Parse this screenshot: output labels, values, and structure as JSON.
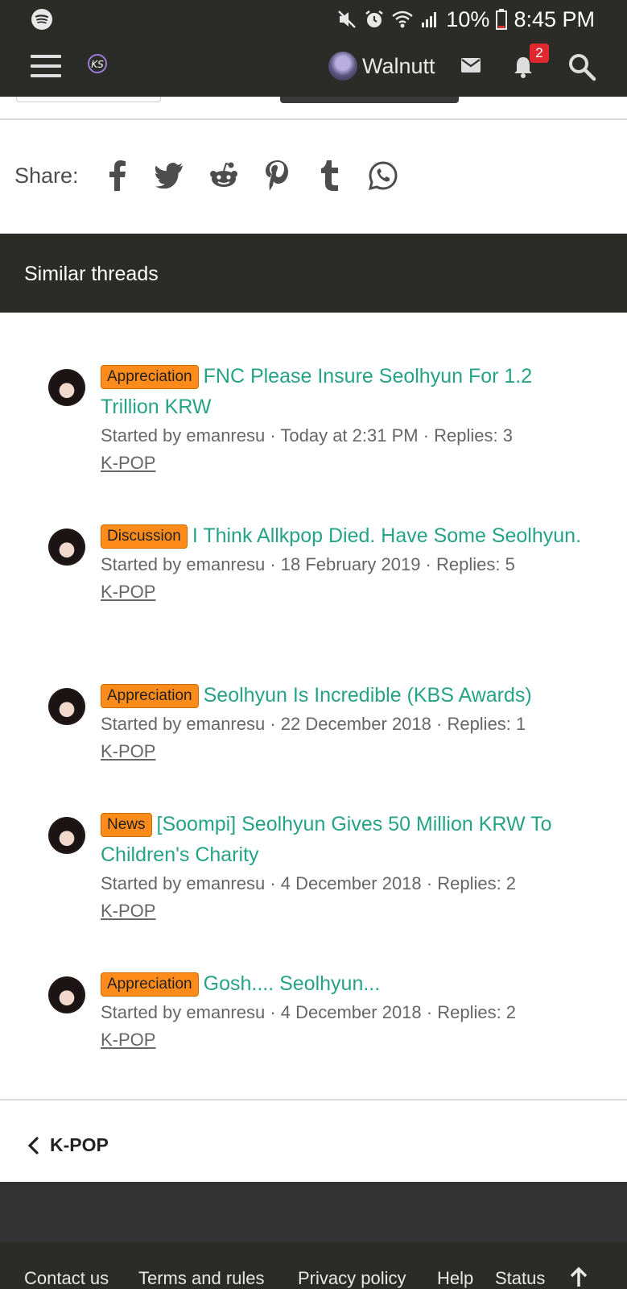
{
  "status_bar": {
    "battery": "10%",
    "time": "8:45 PM"
  },
  "nav": {
    "username": "Walnutt",
    "notification_count": "2"
  },
  "share": {
    "label": "Share:",
    "icons": [
      "facebook-icon",
      "twitter-icon",
      "reddit-icon",
      "pinterest-icon",
      "tumblr-icon",
      "whatsapp-icon"
    ]
  },
  "similar": {
    "title": "Similar threads",
    "threads": [
      {
        "prefix": "Appreciation",
        "title": "FNC Please Insure Seolhyun For 1.2 Trillion KRW",
        "meta": "Started by emanresu · Today at 2:31 PM · Replies: 3",
        "forum": "K-POP"
      },
      {
        "prefix": "Discussion",
        "title": "I Think Allkpop Died. Have Some Seolhyun.",
        "meta": "Started by emanresu · 18 February 2019 · Replies: 5",
        "forum": "K-POP"
      },
      {
        "prefix": "Appreciation",
        "title": "Seolhyun Is Incredible (KBS Awards)",
        "meta": "Started by emanresu · 22 December 2018 · Replies: 1",
        "forum": "K-POP"
      },
      {
        "prefix": "News",
        "title": "[Soompi] Seolhyun Gives 50 Million KRW To Children's Charity",
        "meta": "Started by emanresu · 4 December 2018 · Replies: 2",
        "forum": "K-POP"
      },
      {
        "prefix": "Appreciation",
        "title": "Gosh.... Seolhyun...",
        "meta": "Started by emanresu · 4 December 2018 · Replies: 2",
        "forum": "K-POP"
      }
    ]
  },
  "breadcrumb": {
    "label": "K-POP"
  },
  "footer": {
    "links": [
      "Contact us",
      "Terms and rules",
      "Privacy policy",
      "Help",
      "Status"
    ]
  },
  "colors": {
    "header_bg": "#2b2c28",
    "link": "#26a386",
    "prefix_bg": "#ff8c1a",
    "badge": "#e0282e"
  }
}
